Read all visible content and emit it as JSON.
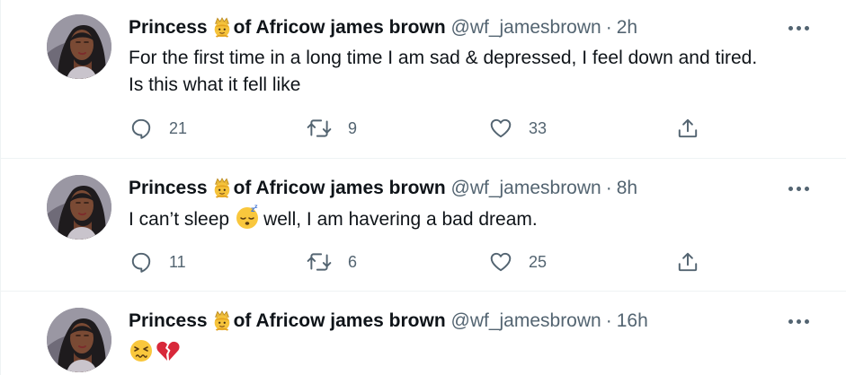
{
  "tweets": [
    {
      "display_name_prefix": "Princess",
      "display_name_suffix": "of Africow james brown",
      "crown_emoji": "person-with-crown-emoji",
      "handle": "@wf_jamesbrown",
      "separator": "·",
      "time": "2h",
      "text_lines": [
        "For the first time in a long time I am sad & depressed, I feel down and tired.",
        "Is this what it fell like"
      ],
      "replies": "21",
      "retweets": "9",
      "likes": "33"
    },
    {
      "display_name_prefix": "Princess",
      "display_name_suffix": "of Africow james brown",
      "crown_emoji": "person-with-crown-emoji",
      "handle": "@wf_jamesbrown",
      "separator": "·",
      "time": "8h",
      "text_before": "I can’t sleep",
      "text_emoji": "sleeping-face-emoji",
      "text_after": "well, I am havering a bad dream.",
      "replies": "11",
      "retweets": "6",
      "likes": "25"
    },
    {
      "display_name_prefix": "Princess",
      "display_name_suffix": "of Africow james brown",
      "crown_emoji": "person-with-crown-emoji",
      "handle": "@wf_jamesbrown",
      "separator": "·",
      "time": "16h",
      "text_emojis": [
        "persevering-face-emoji",
        "broken-heart-emoji"
      ]
    }
  ],
  "colors": {
    "text_primary": "#0f1419",
    "text_secondary": "#536471",
    "divider": "#eff3f4",
    "background": "#ffffff"
  },
  "icons": {
    "reply": "reply-icon",
    "retweet": "retweet-icon",
    "like": "heart-icon",
    "share": "share-icon",
    "more": "more-icon"
  }
}
